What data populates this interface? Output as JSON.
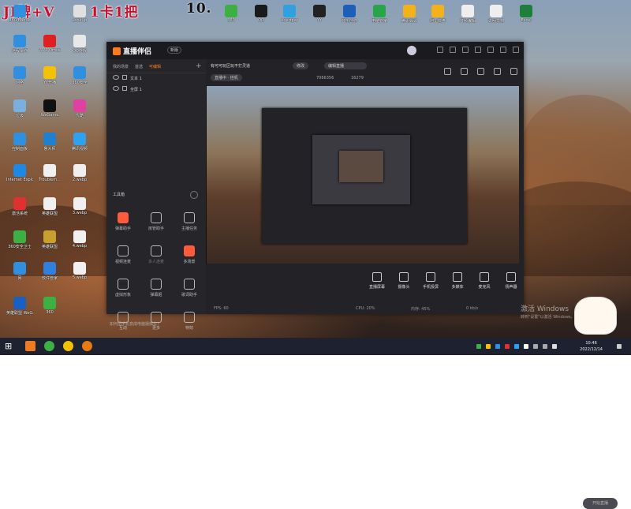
{
  "overlay": {
    "text1": "JI牌+V",
    "text2": "1卡1把",
    "text3": "10."
  },
  "desktop_icons": [
    {
      "label": "360/Bahuk",
      "color": "#2f8fe0"
    },
    {
      "label": "LookUp",
      "color": "#e0e0e0"
    },
    {
      "label": "360",
      "color": "#3cb043"
    },
    {
      "label": "QQ",
      "color": "#1a1a1a"
    },
    {
      "label": "ubertpar",
      "color": "#2fa0e0"
    },
    {
      "label": "YY",
      "color": "#222"
    },
    {
      "label": "音乐创作",
      "color": "#1c5fb8"
    },
    {
      "label": "电脑管家",
      "color": "#27a548"
    },
    {
      "label": "腾讯会议",
      "color": "#f3b21a"
    },
    {
      "label": "阿里云盘",
      "color": "#f3b21a"
    },
    {
      "label": "音频编辑",
      "color": "#eee"
    },
    {
      "label": "说明文档",
      "color": "#eee"
    },
    {
      "label": "Excel",
      "color": "#1e7f3c"
    },
    {
      "label": "远程桌面",
      "color": "#2f8fe0"
    },
    {
      "label": "WPS Office",
      "color": "#e02020"
    },
    {
      "label": "QQ游戏",
      "color": "#e8e8e8"
    },
    {
      "label": "网络",
      "color": "#2f8fe0"
    },
    {
      "label": "YY开播",
      "color": "#f3c200"
    },
    {
      "label": "360安全",
      "color": "#2f8fe0"
    },
    {
      "label": "垃圾",
      "color": "#7ab0e0"
    },
    {
      "label": "WeGame",
      "color": "#111"
    },
    {
      "label": "优酷",
      "color": "#e040a0"
    },
    {
      "label": "控制面板",
      "color": "#2f8fe0"
    },
    {
      "label": "鲁大师",
      "color": "#2080d0"
    },
    {
      "label": "腾讯视频",
      "color": "#30a0f0"
    },
    {
      "label": "Internet Explorer",
      "color": "#1e88e5"
    },
    {
      "label": "Troublem...",
      "color": "#f0f0f0"
    },
    {
      "label": "2.webp",
      "color": "#f0f0f0"
    },
    {
      "label": "激活系统",
      "color": "#e03030"
    },
    {
      "label": "英雄联盟",
      "color": "#f0f0f0"
    },
    {
      "label": "3.webp",
      "color": "#f0f0f0"
    },
    {
      "label": "360安全卫士",
      "color": "#3cb043"
    },
    {
      "label": "英雄联盟",
      "color": "#c8a030"
    },
    {
      "label": "4.webp",
      "color": "#f0f0f0"
    },
    {
      "label": "网",
      "color": "#2f8fe0"
    },
    {
      "label": "软件管家",
      "color": "#3080e0"
    },
    {
      "label": "5.webp",
      "color": "#f0f0f0"
    },
    {
      "label": "英雄联盟 WeGame版",
      "color": "#1a60c0"
    },
    {
      "label": "360",
      "color": "#3cb043"
    }
  ],
  "app": {
    "logo": "直播伴侣",
    "version": "新版",
    "left_tabs": [
      {
        "label": "我的场景"
      },
      {
        "label": "首选"
      },
      {
        "label": "可编辑",
        "active": true
      }
    ],
    "sources": [
      {
        "label": "文本 1"
      },
      {
        "label": "全屏 1"
      }
    ],
    "tools_heading": "工具箱",
    "tools": [
      {
        "label": "弹幕助手",
        "hot": true
      },
      {
        "label": "房管助手"
      },
      {
        "label": "主播任务"
      },
      {
        "label": "视频连麦"
      },
      {
        "label": "多人连麦",
        "dim": true
      },
      {
        "label": "多场景",
        "hot": true
      },
      {
        "label": "虚拟形象"
      },
      {
        "label": "弹幕姬"
      },
      {
        "label": "歌词助手"
      },
      {
        "label": "互动"
      },
      {
        "label": "更多"
      },
      {
        "label": "特效"
      }
    ],
    "notice": "如何把手机变成电脑摄像头？",
    "room_title": "有可可玩区玩不打灵道",
    "edit_chip": "修改",
    "tag_chip": "编辑直播",
    "stats": {
      "live_status": "直播中 · 挂机",
      "viewers": "7066356",
      "likes": "16279"
    },
    "bottom_buttons": [
      {
        "label": "直播屏幕"
      },
      {
        "label": "摄像头"
      },
      {
        "label": "手机投屏"
      },
      {
        "label": "多媒体"
      },
      {
        "label": "麦克风"
      },
      {
        "label": "扬声器"
      }
    ],
    "start_button": "开始直播",
    "status": {
      "fps": "FPS: 60",
      "cpu": "CPU: 20%",
      "mem": "内存: 45%",
      "net": "0 kb/s"
    }
  },
  "activate": {
    "line1": "激活 Windows",
    "line2": "转到\"设置\"以激活 Windows。"
  },
  "taskbar": {
    "time": "10:46",
    "date": "2022/12/14"
  }
}
